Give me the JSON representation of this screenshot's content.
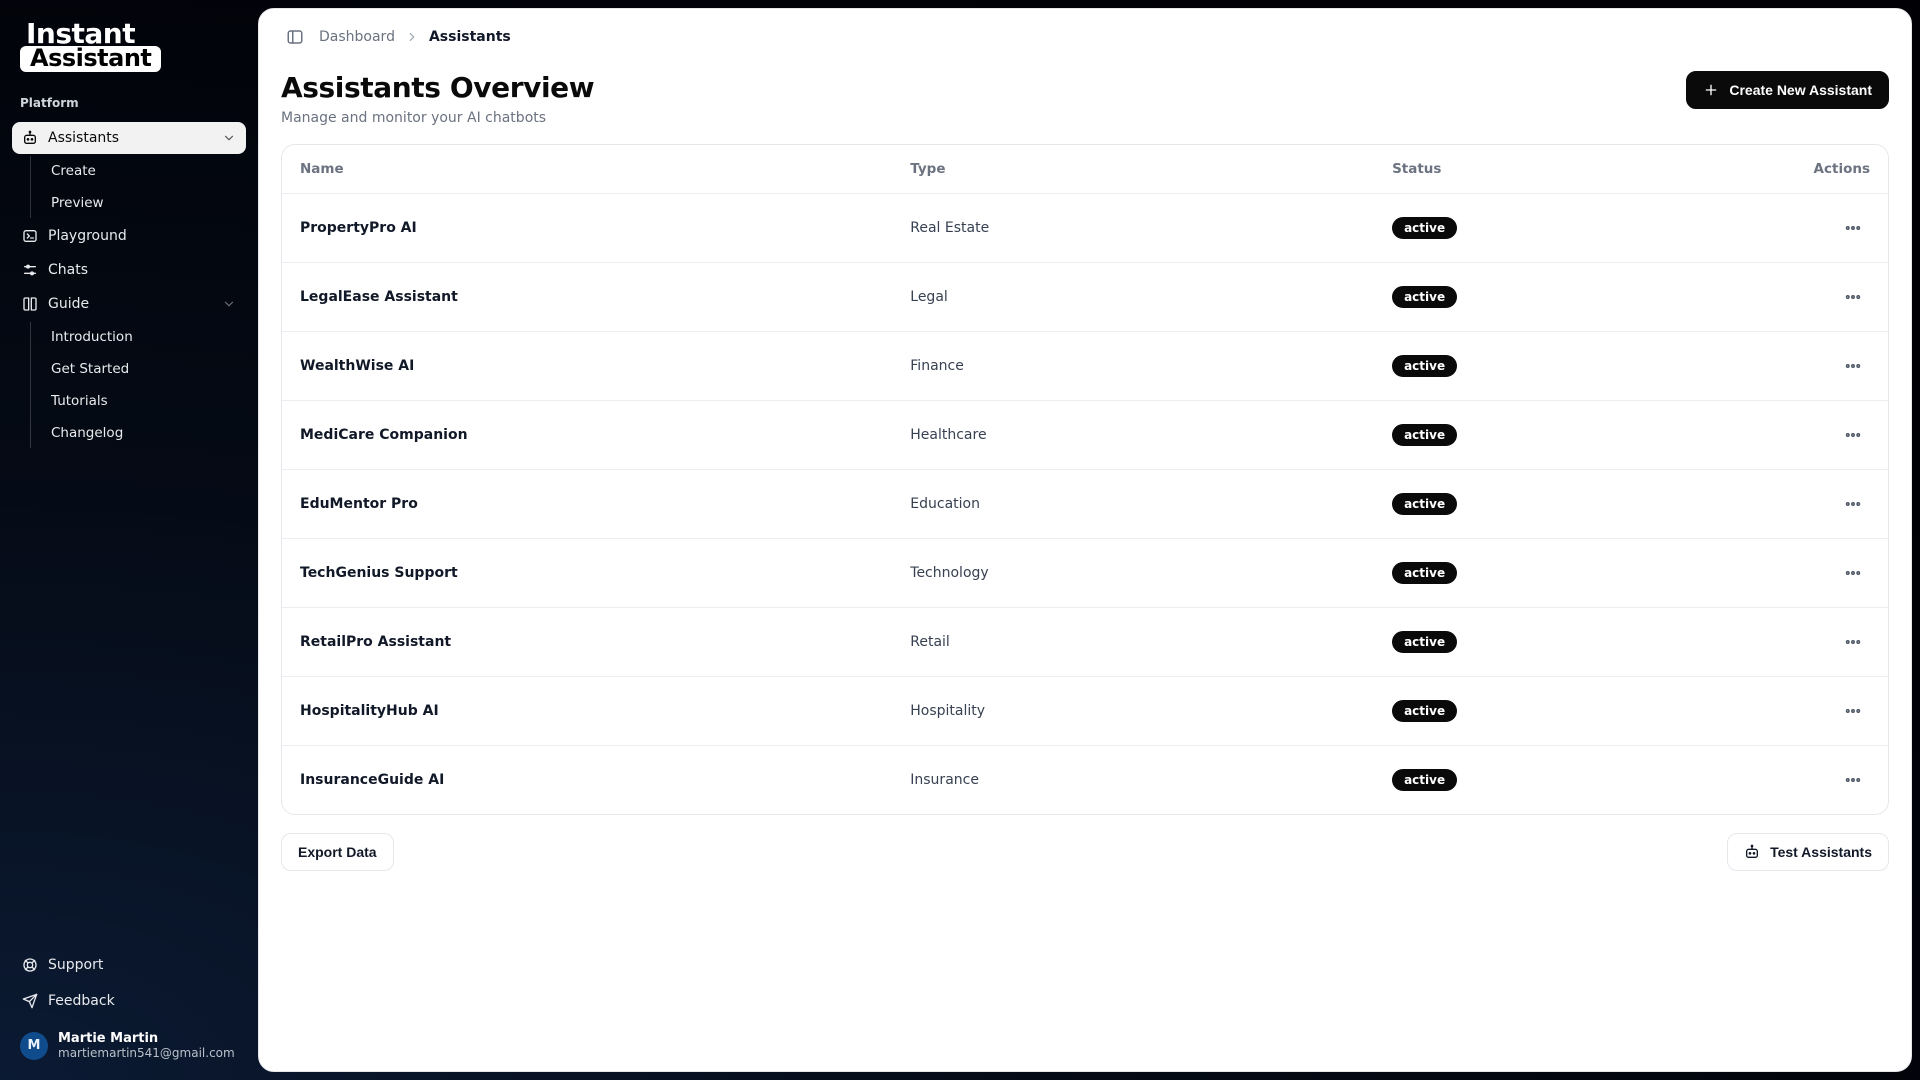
{
  "brand": {
    "line1": "Instant",
    "line2": "Assistant"
  },
  "sidebar": {
    "section_label": "Platform",
    "items": {
      "assistants": {
        "label": "Assistants",
        "sub": {
          "create": "Create",
          "preview": "Preview"
        }
      },
      "playground": {
        "label": "Playground"
      },
      "chats": {
        "label": "Chats"
      },
      "guide": {
        "label": "Guide",
        "sub": {
          "introduction": "Introduction",
          "get_started": "Get Started",
          "tutorials": "Tutorials",
          "changelog": "Changelog"
        }
      }
    },
    "footer": {
      "support": "Support",
      "feedback": "Feedback"
    },
    "user": {
      "initial": "M",
      "name": "Martie Martin",
      "email": "martiemartin541@gmail.com"
    }
  },
  "breadcrumbs": {
    "root": "Dashboard",
    "current": "Assistants"
  },
  "page": {
    "title": "Assistants Overview",
    "subtitle": "Manage and monitor your AI chatbots",
    "create_button": "Create New Assistant",
    "export_button": "Export Data",
    "test_button": "Test Assistants"
  },
  "table": {
    "columns": {
      "name": "Name",
      "type": "Type",
      "status": "Status",
      "actions": "Actions"
    },
    "rows": [
      {
        "name": "PropertyPro AI",
        "type": "Real Estate",
        "status": "active"
      },
      {
        "name": "LegalEase Assistant",
        "type": "Legal",
        "status": "active"
      },
      {
        "name": "WealthWise AI",
        "type": "Finance",
        "status": "active"
      },
      {
        "name": "MediCare Companion",
        "type": "Healthcare",
        "status": "active"
      },
      {
        "name": "EduMentor Pro",
        "type": "Education",
        "status": "active"
      },
      {
        "name": "TechGenius Support",
        "type": "Technology",
        "status": "active"
      },
      {
        "name": "RetailPro Assistant",
        "type": "Retail",
        "status": "active"
      },
      {
        "name": "HospitalityHub AI",
        "type": "Hospitality",
        "status": "active"
      },
      {
        "name": "InsuranceGuide AI",
        "type": "Insurance",
        "status": "active"
      }
    ]
  }
}
